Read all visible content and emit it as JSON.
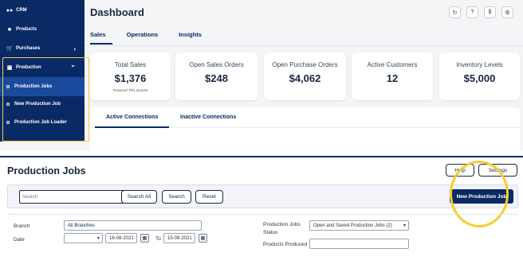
{
  "sidebar": {
    "items": [
      {
        "label": "CRM",
        "icon": "people-icon"
      },
      {
        "label": "Products",
        "icon": "box-icon"
      },
      {
        "label": "Purchases",
        "icon": "cart-icon",
        "chevron": "›"
      },
      {
        "label": "Production",
        "icon": "factory-icon",
        "chevron": "⌄"
      }
    ],
    "sub_items": [
      {
        "label": "Production Jobs"
      },
      {
        "label": "New Production Job"
      },
      {
        "label": "Production Job Loader"
      }
    ]
  },
  "dashboard": {
    "title": "Dashboard",
    "header_icons": [
      "refresh-icon",
      "help-icon",
      "dollar-icon",
      "gear-icon"
    ],
    "header_glyphs": [
      "↻",
      "?",
      "$",
      "⚙"
    ],
    "tabs": [
      {
        "label": "Sales"
      },
      {
        "label": "Operations"
      },
      {
        "label": "Insights"
      }
    ],
    "cards": [
      {
        "label": "Total Sales",
        "value": "$1,376",
        "note": "*Invoiced This Quarter"
      },
      {
        "label": "Open Sales Orders",
        "value": "$248"
      },
      {
        "label": "Open Purchase Orders",
        "value": "$4,062"
      },
      {
        "label": "Active Customers",
        "value": "12"
      },
      {
        "label": "Inventory Levels",
        "value": "$5,000"
      }
    ],
    "connections": {
      "active": "Active Connections",
      "inactive": "Inactive Connections"
    }
  },
  "production_jobs": {
    "title": "Production Jobs",
    "help_label": "Help",
    "settings_label": "Settings",
    "search_placeholder": "Search",
    "search_all_label": "Search All",
    "search_label": "Search",
    "reset_label": "Reset",
    "new_job_label": "New Production Job",
    "branch_label": "Branch",
    "branch_value": "All Branches",
    "date_label": "Date",
    "date_from": "16-08-2021",
    "date_to_label": "To",
    "date_to": "15-09-2021",
    "status_label_line1": "Production Jobs",
    "status_label_line2": "Status",
    "status_value": "Open and Saved Production Jobs (2)",
    "products_produced_label": "Products Produced"
  },
  "colors": {
    "navy": "#0a2a66",
    "highlight_yellow": "#f6cd2f"
  }
}
